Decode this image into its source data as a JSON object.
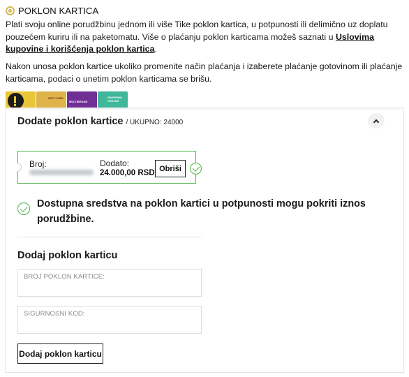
{
  "section": {
    "title": "POKLON KARTICA",
    "intro_text": "Plati svoju online porudžbinu jednom ili više Tike poklon kartica, u potpunosti ili delimično uz doplatu pouzećem kuriru ili na paketomatu. Više o plaćanju poklon karticama možeš saznati u ",
    "terms_link": "Uslovima kupovine i korišćenja poklon kartica",
    "intro_suffix": ".",
    "warning_text": "Nakon unosa poklon kartice ukoliko promenite način plaćanja i izaberete plaćanje gotovinom ili plaćanje karticama, podaci o unetim poklon karticama se brišu.",
    "card_icons": [
      {
        "name": "tike-card-icon",
        "color": "#e8c638"
      },
      {
        "name": "gift-card-icon",
        "color": "#e0b24a",
        "text": "GIFT CARD"
      },
      {
        "name": "multibrand-card-icon",
        "color": "#6f2f96",
        "text": "MULTIBRAND"
      },
      {
        "name": "shopping-centar-card-icon",
        "color": "#3fb79a",
        "text": "SHOPPING CENTAR"
      }
    ]
  },
  "panel": {
    "title": "Dodate poklon kartice",
    "total_label": "/ UKUPNO: 24000",
    "applied_card": {
      "number_label": "Broj:",
      "amount_label": "Dodato:",
      "amount_value": "24.000,00 RSD",
      "remove_label": "Obriši"
    },
    "success_message": "Dostupna sredstva na poklon kartici u potpunosti mogu pokriti iznos porudžbine.",
    "add_section_title": "Dodaj poklon karticu",
    "card_number_placeholder": "BROJ POKLON KARTICE:",
    "security_code_placeholder": "SIGURNOSNI KOD:",
    "add_button_label": "Dodaj poklon karticu"
  },
  "colors": {
    "accent_gold": "#d4b85a",
    "success_green": "#49b54a"
  }
}
